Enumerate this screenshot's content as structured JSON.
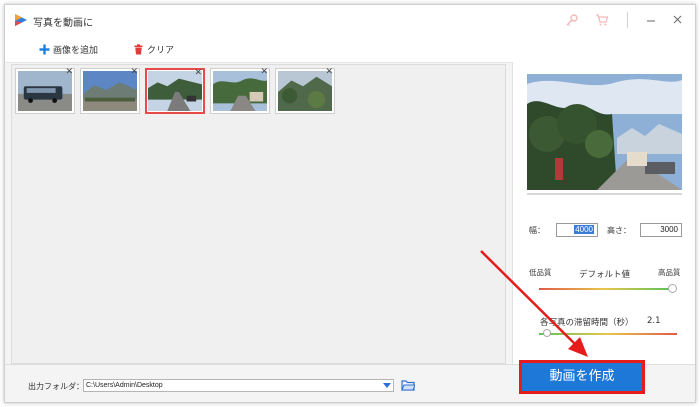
{
  "window": {
    "title": "写真を動画に"
  },
  "toolbar": {
    "add_image": "画像を追加",
    "clear": "クリア"
  },
  "thumbnails": [
    {
      "scene": "bus",
      "selected": false
    },
    {
      "scene": "mountains",
      "selected": false
    },
    {
      "scene": "road",
      "selected": true
    },
    {
      "scene": "town",
      "selected": false
    },
    {
      "scene": "hill",
      "selected": false
    }
  ],
  "settings": {
    "width_label": "幅：",
    "width_value": "4000",
    "height_label": "高さ：",
    "height_value": "3000",
    "quality_low": "低品質",
    "quality_default": "デフォルト値",
    "quality_high": "高品質",
    "duration_label": "各写真の滞留時間（秒）",
    "duration_value": "2.1"
  },
  "output": {
    "label": "出力フォルダ：",
    "path": "C:\\Users\\Admin\\Desktop"
  },
  "actions": {
    "create_video": "動画を作成"
  },
  "colors": {
    "accent": "#1e78d8",
    "highlight": "#e61c1c",
    "clear_icon": "#e23b3b",
    "add_icon": "#1a7fe0"
  }
}
